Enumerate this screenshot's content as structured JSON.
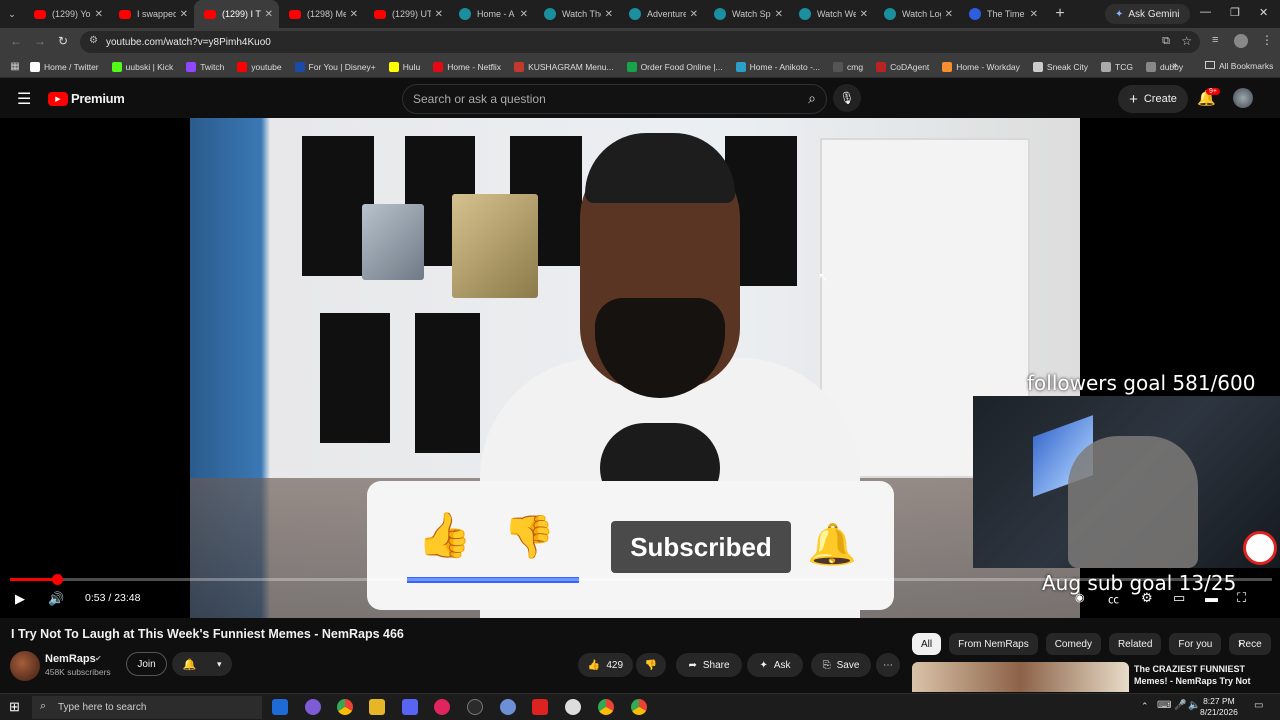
{
  "browser": {
    "tabs": [
      {
        "label": "(1299) You",
        "icon": "youtube-icon"
      },
      {
        "label": "I swapped",
        "icon": "youtube-icon"
      },
      {
        "label": "(1299) I Try",
        "icon": "youtube-icon",
        "active": true
      },
      {
        "label": "(1298) Me",
        "icon": "youtube-icon"
      },
      {
        "label": "(1299) UTI",
        "icon": "youtube-icon"
      },
      {
        "label": "Home - A",
        "icon": "globe-icon"
      },
      {
        "label": "Watch The",
        "icon": "globe-icon"
      },
      {
        "label": "Adventure",
        "icon": "globe-icon"
      },
      {
        "label": "Watch Spe",
        "icon": "globe-icon"
      },
      {
        "label": "Watch We",
        "icon": "globe-icon"
      },
      {
        "label": "Watch Log",
        "icon": "globe-icon"
      },
      {
        "label": "The Time",
        "icon": "globe-icon"
      }
    ],
    "ask_gemini": "Ask Gemini",
    "url": "youtube.com/watch?v=y8Pimh4Kuo0",
    "bookmarks": [
      "Home / Twitter",
      "uubski | Kick",
      "Twitch",
      "youtube",
      "For You | Disney+",
      "Hulu",
      "Home - Netflix",
      "KUSHAGRAM Menu...",
      "Order Food Online |...",
      "Home - Anikoto -...",
      "cmg",
      "CoDAgent",
      "Home - Workday",
      "Sneak City",
      "TCG",
      "dubby"
    ],
    "all_bookmarks": "All Bookmarks"
  },
  "youtube": {
    "logo": "Premium",
    "search_placeholder": "Search or ask a question",
    "create_label": "Create",
    "notification_badge": "9+"
  },
  "player": {
    "overlay_followers": "followers goal 581/600",
    "overlay_subs": "Aug sub goal 13/25",
    "subscribed_label": "Subscribed",
    "time": "0:53 / 23:48",
    "progress": 0.037
  },
  "video": {
    "title": "I Try Not To Laugh at This Week's Funniest Memes - NemRaps 466",
    "channel": "NemRaps",
    "subscribers": "458K subscribers",
    "join": "Join",
    "likes": "429",
    "share": "Share",
    "ask": "Ask",
    "save": "Save"
  },
  "chips": [
    "All",
    "From NemRaps",
    "Comedy",
    "Related",
    "For you",
    "Rece"
  ],
  "recommendation": {
    "title": "The CRAZIEST FUNNIEST Memes! - NemRaps Try Not"
  },
  "taskbar": {
    "search_placeholder": "Type here to search",
    "time": "8:27 PM",
    "date": "8/21/2026"
  }
}
